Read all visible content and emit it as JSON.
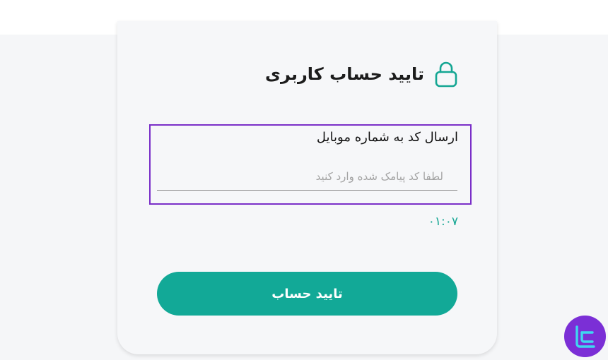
{
  "header": {
    "title": "تایید حساب کاربری",
    "icon": "lock-icon"
  },
  "form": {
    "label": "ارسال کد به شماره موبایل",
    "code_value": "",
    "code_placeholder": "لطفا کد پیامک شده وارد کنید",
    "timer": "۰۱:۰۷",
    "submit_label": "تایید حساب"
  },
  "badge": {
    "icon": "tc-logo-icon"
  },
  "colors": {
    "accent": "#12a997",
    "highlight": "#7a2fc8",
    "badge": "#7b2fd6"
  }
}
